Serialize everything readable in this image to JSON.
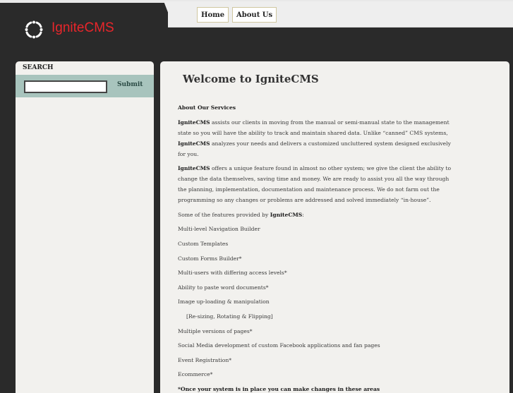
{
  "header": {
    "logo_text": "IgniteCMS",
    "nav": [
      {
        "label": "Home"
      },
      {
        "label": "About Us"
      }
    ]
  },
  "sidebar": {
    "title": "SEARCH",
    "search": {
      "value": "",
      "placeholder": ""
    },
    "submit_label": "Submit"
  },
  "main": {
    "title": "Welcome to IgniteCMS",
    "section_heading": "About Our Services",
    "para1": "IgniteCMS assists our clients in moving from the manual or semi-manual state to the management state so you will have the ability to track and maintain shared data. Unlike “canned” CMS systems, IgniteCMS analyzes your needs and delivers a customized uncluttered system designed exclusively for you.",
    "para2": "IgniteCMS offers a unique feature found in almost no other system; we give the client the ability to change the data themselves, saving time and money. We are ready to assist you all the way through the planning, implementation, documentation and maintenance process. We do not farm out the programming so any changes or problems are addressed and solved immediately “in-house”.",
    "features_intro": "Some of the features provided by IgniteCMS:",
    "features": [
      "Multi-level Navigation Builder",
      "Custom Templates",
      "Custom Forms Builder*",
      "Multi-users with differing access levels*",
      "Ability to paste word documents*",
      "Image up-loading & manipulation",
      "[Re-sizing, Rotating & Flipping]",
      "Multiple versions of pages*",
      "Social Media development of custom Facebook applications and fan pages",
      "Event Registration*",
      "Ecommerce*"
    ],
    "footnote": "*Once your system is in place you can make changes in these areas"
  },
  "colors": {
    "background": "#2a2a2a",
    "logo_red": "#e8262b",
    "search_bar": "#a8c4bd",
    "panel": "#f2f1ee"
  }
}
